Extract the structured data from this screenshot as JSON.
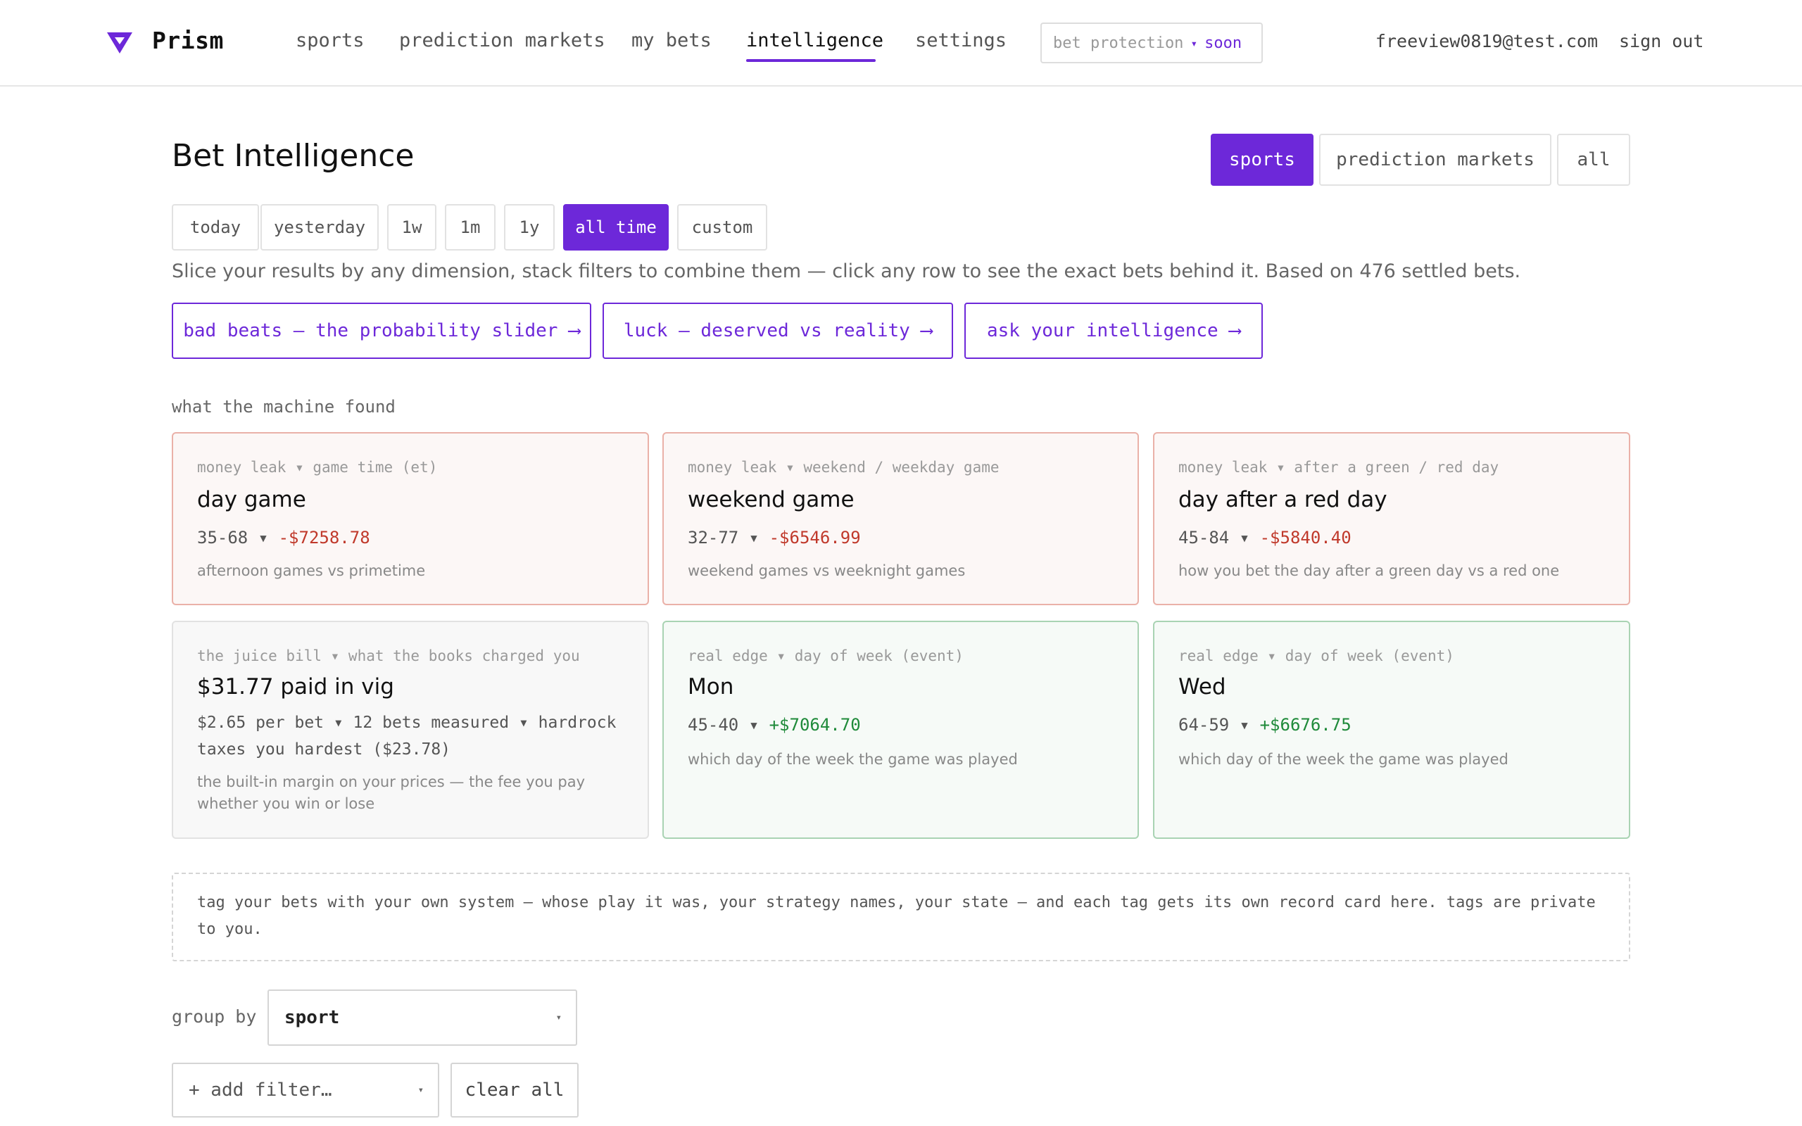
{
  "brand": {
    "name": "Prism",
    "logo_icon": "prism-triangle-icon",
    "accent": "#6d28d9"
  },
  "nav": {
    "items": [
      {
        "label": "sports"
      },
      {
        "label": "prediction markets"
      },
      {
        "label": "my bets"
      },
      {
        "label": "intelligence",
        "active": true
      },
      {
        "label": "settings"
      }
    ],
    "protection": {
      "label": "bet protection",
      "separator": "▾",
      "badge": "soon"
    },
    "user_email": "freeview0819@test.com",
    "sign_out": "sign out"
  },
  "page": {
    "title": "Bet Intelligence",
    "market_tabs": [
      {
        "label": "sports",
        "active": true
      },
      {
        "label": "prediction markets"
      },
      {
        "label": "all"
      }
    ],
    "ranges": [
      {
        "label": "today"
      },
      {
        "label": "yesterday"
      },
      {
        "label": "1w"
      },
      {
        "label": "1m"
      },
      {
        "label": "1y"
      },
      {
        "label": "all time",
        "active": true
      },
      {
        "label": "custom"
      }
    ],
    "description": "Slice your results by any dimension, stack filters to combine them — click any row to see the exact bets behind it. Based on 476 settled bets.",
    "ctas": [
      {
        "label": "bad beats — the probability slider ⟶"
      },
      {
        "label": "luck — deserved vs reality ⟶"
      },
      {
        "label": "ask your intelligence ⟶"
      }
    ]
  },
  "findings": {
    "section_label": "what the machine found",
    "cards": [
      {
        "kind": "leak",
        "kicker": "money leak ▾ game time (et)",
        "headline": "day game",
        "record": "35-68",
        "sep": "▾",
        "amount": "-$7258.78",
        "note": "afternoon games vs primetime"
      },
      {
        "kind": "leak",
        "kicker": "money leak ▾ weekend / weekday game",
        "headline": "weekend game",
        "record": "32-77",
        "sep": "▾",
        "amount": "-$6546.99",
        "note": "weekend games vs weeknight games"
      },
      {
        "kind": "leak",
        "kicker": "money leak ▾ after a green / red day",
        "headline": "day after a red day",
        "record": "45-84",
        "sep": "▾",
        "amount": "-$5840.40",
        "note": "how you bet the day after a green day vs a red one"
      },
      {
        "kind": "neutral",
        "kicker": "the juice bill ▾ what the books charged you",
        "headline": "$31.77 paid in vig",
        "details": "$2.65 per bet ▾ 12 bets measured ▾ hardrock taxes you hardest ($23.78)",
        "note": "the built-in margin on your prices — the fee you pay whether you win or lose"
      },
      {
        "kind": "edge",
        "kicker": "real edge ▾ day of week (event)",
        "headline": "Mon",
        "record": "45-40",
        "sep": "▾",
        "amount": "+$7064.70",
        "note": "which day of the week the game was played"
      },
      {
        "kind": "edge",
        "kicker": "real edge ▾ day of week (event)",
        "headline": "Wed",
        "record": "64-59",
        "sep": "▾",
        "amount": "+$6676.75",
        "note": "which day of the week the game was played"
      }
    ]
  },
  "tags": {
    "text": "tag your bets with your own system — whose play it was, your strategy names, your state — and each tag gets its own record card here. tags are private to you."
  },
  "controls": {
    "group_by_label": "group by",
    "group_by_value": "sport",
    "add_filter_placeholder": "+ add filter…",
    "clear_all": "clear all",
    "caret_icon": "caret-down-icon"
  },
  "colors": {
    "negative": "#c0392b",
    "positive": "#1f8a3a",
    "leak_border": "#eab1a8",
    "edge_border": "#a9d3b3"
  }
}
